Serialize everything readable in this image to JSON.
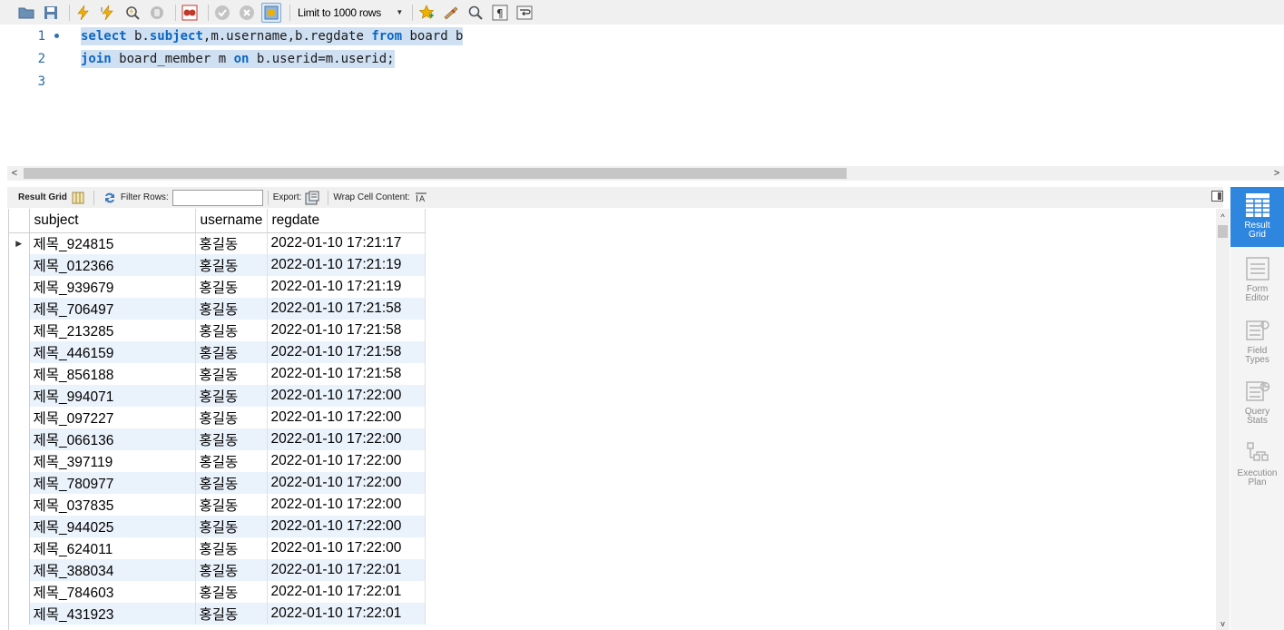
{
  "toolbar": {
    "limit_label": "Limit to 1000 rows",
    "icons": [
      "open-folder-icon",
      "save-icon",
      "execute-icon",
      "execute-current-icon",
      "explain-icon",
      "stop-icon",
      "toggle-error-icon",
      "commit-icon",
      "rollback-icon",
      "autocommit-icon",
      "bookmark-icon",
      "beautify-icon",
      "find-icon",
      "invisible-chars-icon",
      "wrap-icon"
    ]
  },
  "editor": {
    "line_numbers": [
      "1",
      "2",
      "3"
    ],
    "lines": [
      [
        {
          "t": "select",
          "kw": true
        },
        {
          "t": " b.",
          "kw": false
        },
        {
          "t": "subject",
          "kw": true
        },
        {
          "t": ",m.username,b.regdate ",
          "kw": false
        },
        {
          "t": "from",
          "kw": true
        },
        {
          "t": " board b",
          "kw": false
        }
      ],
      [
        {
          "t": "join",
          "kw": true
        },
        {
          "t": " board_member m ",
          "kw": false
        },
        {
          "t": "on",
          "kw": true
        },
        {
          "t": " b.userid=m.userid;",
          "kw": false
        }
      ],
      []
    ]
  },
  "result_toolbar": {
    "result_grid": "Result Grid",
    "filter_rows": "Filter Rows:",
    "export": "Export:",
    "wrap_cell": "Wrap Cell Content:"
  },
  "grid": {
    "columns": [
      "subject",
      "username",
      "regdate"
    ],
    "rows": [
      [
        "제목_924815",
        "홍길동",
        "2022-01-10 17:21:17"
      ],
      [
        "제목_012366",
        "홍길동",
        "2022-01-10 17:21:19"
      ],
      [
        "제목_939679",
        "홍길동",
        "2022-01-10 17:21:19"
      ],
      [
        "제목_706497",
        "홍길동",
        "2022-01-10 17:21:58"
      ],
      [
        "제목_213285",
        "홍길동",
        "2022-01-10 17:21:58"
      ],
      [
        "제목_446159",
        "홍길동",
        "2022-01-10 17:21:58"
      ],
      [
        "제목_856188",
        "홍길동",
        "2022-01-10 17:21:58"
      ],
      [
        "제목_994071",
        "홍길동",
        "2022-01-10 17:22:00"
      ],
      [
        "제목_097227",
        "홍길동",
        "2022-01-10 17:22:00"
      ],
      [
        "제목_066136",
        "홍길동",
        "2022-01-10 17:22:00"
      ],
      [
        "제목_397119",
        "홍길동",
        "2022-01-10 17:22:00"
      ],
      [
        "제목_780977",
        "홍길동",
        "2022-01-10 17:22:00"
      ],
      [
        "제목_037835",
        "홍길동",
        "2022-01-10 17:22:00"
      ],
      [
        "제목_944025",
        "홍길동",
        "2022-01-10 17:22:00"
      ],
      [
        "제목_624011",
        "홍길동",
        "2022-01-10 17:22:00"
      ],
      [
        "제목_388034",
        "홍길동",
        "2022-01-10 17:22:01"
      ],
      [
        "제목_784603",
        "홍길동",
        "2022-01-10 17:22:01"
      ],
      [
        "제목_431923",
        "홍길동",
        "2022-01-10 17:22:01"
      ]
    ]
  },
  "side_panel": [
    {
      "label1": "Result",
      "label2": "Grid",
      "active": true
    },
    {
      "label1": "Form",
      "label2": "Editor",
      "active": false
    },
    {
      "label1": "Field",
      "label2": "Types",
      "active": false
    },
    {
      "label1": "Query",
      "label2": "Stats",
      "active": false
    },
    {
      "label1": "Execution",
      "label2": "Plan",
      "active": false
    }
  ],
  "colors": {
    "keyword": "#0b66c3",
    "selection": "#cfe0f3",
    "row_alt": "#eaf2fb",
    "side_active": "#2e86de"
  }
}
